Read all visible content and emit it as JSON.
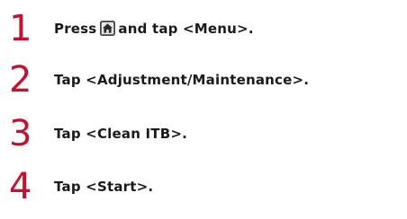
{
  "steps": [
    {
      "number": "1",
      "text_before_icon": "Press",
      "icon": "home-icon",
      "text_after_icon": "and tap <Menu>."
    },
    {
      "number": "2",
      "text": "Tap <Adjustment/Maintenance>."
    },
    {
      "number": "3",
      "text": "Tap <Clean ITB>."
    },
    {
      "number": "4",
      "text": "Tap <Start>."
    }
  ],
  "colors": {
    "step_number": "#c8102e",
    "step_text": "#1a1a1a"
  }
}
